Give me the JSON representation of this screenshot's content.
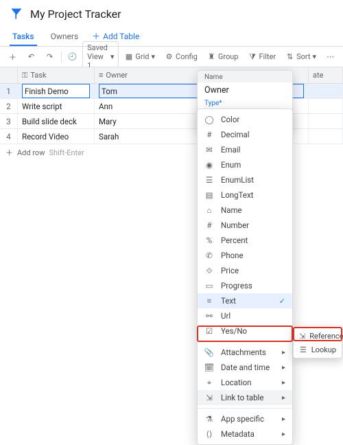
{
  "app": {
    "title": "My Project Tracker"
  },
  "tabs": {
    "tasks": "Tasks",
    "owners": "Owners",
    "add": "Add Table"
  },
  "toolbar": {
    "view": "Saved View 1",
    "grid": "Grid",
    "config": "Config",
    "group": "Group",
    "filter": "Filter",
    "sort": "Sort"
  },
  "columns": {
    "task": "Task",
    "owner": "Owner",
    "date": "ate"
  },
  "rows": [
    {
      "n": "1",
      "task": "Finish Demo",
      "owner": "Tom"
    },
    {
      "n": "2",
      "task": "Write script",
      "owner": "Ann"
    },
    {
      "n": "3",
      "task": "Build slide deck",
      "owner": "Mary"
    },
    {
      "n": "4",
      "task": "Record Video",
      "owner": "Sarah"
    }
  ],
  "addrow": {
    "label": "Add row",
    "hint": "Shift-Enter"
  },
  "panel": {
    "name_label": "Name",
    "name_value": "Owner",
    "type_label": "Type*",
    "type_value": "Text"
  },
  "type_items": {
    "color": "Color",
    "decimal": "Decimal",
    "email": "Email",
    "enum": "Enum",
    "enumlist": "EnumList",
    "longtext": "LongText",
    "name": "Name",
    "number": "Number",
    "percent": "Percent",
    "phone": "Phone",
    "price": "Price",
    "progress": "Progress",
    "text": "Text",
    "url": "Url",
    "yesno": "Yes/No",
    "attachments": "Attachments",
    "datetime": "Date and time",
    "location": "Location",
    "linktotable": "Link to table",
    "appspecific": "App specific",
    "metadata": "Metadata"
  },
  "submenu": {
    "reference": "Reference",
    "lookup": "Lookup"
  }
}
